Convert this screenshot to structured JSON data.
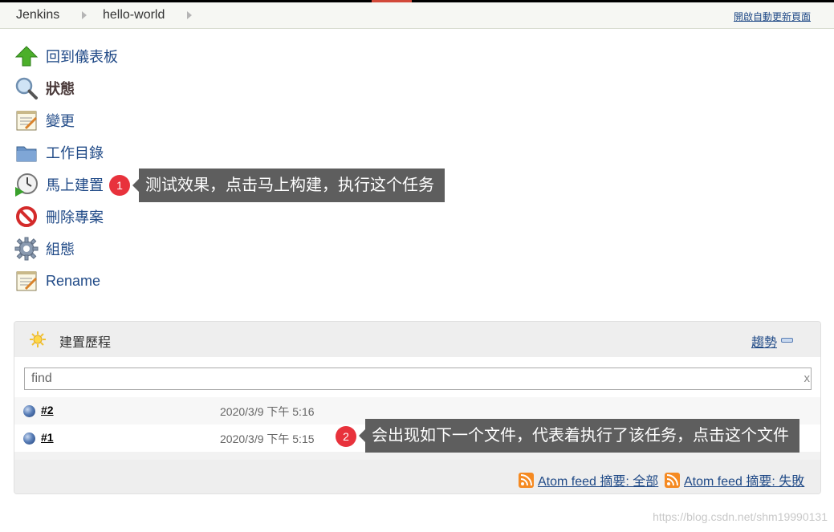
{
  "breadcrumb": {
    "items": [
      "Jenkins",
      "hello-world"
    ],
    "auto_refresh": "開啟自動更新頁面"
  },
  "tasks": [
    {
      "label": "回到儀表板",
      "icon": "up-arrow-icon"
    },
    {
      "label": "狀態",
      "icon": "magnifier-icon"
    },
    {
      "label": "變更",
      "icon": "notepad-icon"
    },
    {
      "label": "工作目錄",
      "icon": "folder-icon"
    },
    {
      "label": "馬上建置",
      "icon": "clock-play-icon"
    },
    {
      "label": "刪除專案",
      "icon": "no-entry-icon"
    },
    {
      "label": "組態",
      "icon": "gear-icon"
    },
    {
      "label": "Rename",
      "icon": "notepad-icon"
    }
  ],
  "annotations": [
    {
      "badge": "1",
      "text": "测试效果，点击马上构建，执行这个任务"
    },
    {
      "badge": "2",
      "text": "会出现如下一个文件，代表着执行了该任务，点击这个文件"
    }
  ],
  "build_history": {
    "title": "建置歷程",
    "trend": "趨勢",
    "search_value": "find",
    "clear": "x",
    "builds": [
      {
        "number": "#2",
        "date": "2020/3/9 下午 5:16"
      },
      {
        "number": "#1",
        "date": "2020/3/9 下午 5:15"
      }
    ],
    "feeds": [
      "Atom feed 摘要: 全部",
      "Atom feed 摘要: 失敗"
    ]
  },
  "watermark": "https://blog.csdn.net/shm19990131",
  "colors": {
    "link": "#204a87",
    "callout": "#5e5e5e",
    "badge": "#e8323c",
    "rss": "#f58a22"
  }
}
